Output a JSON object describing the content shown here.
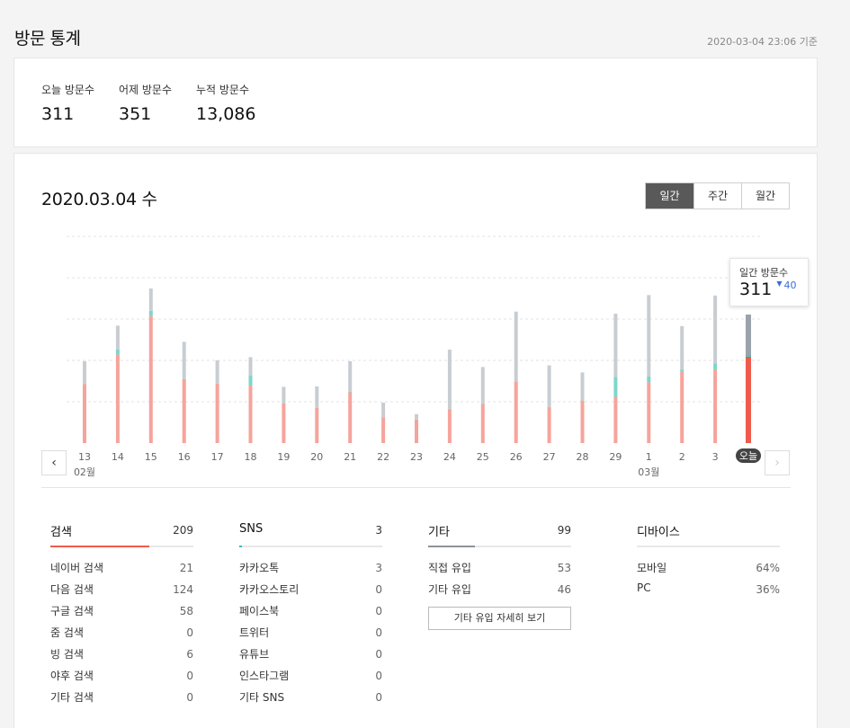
{
  "header": {
    "title": "방문 통계",
    "updated": "2020-03-04 23:06 기준"
  },
  "summary": [
    {
      "label": "오늘 방문수",
      "value": "311"
    },
    {
      "label": "어제 방문수",
      "value": "351"
    },
    {
      "label": "누적 방문수",
      "value": "13,086"
    }
  ],
  "date_title": "2020.03.04 수",
  "period_tabs": [
    "일간",
    "주간",
    "월간"
  ],
  "tooltip": {
    "label": "일간 방문수",
    "value": "311",
    "delta": "40"
  },
  "chart_data": {
    "type": "bar",
    "stacked": true,
    "categories": [
      "13",
      "14",
      "15",
      "16",
      "17",
      "18",
      "19",
      "20",
      "21",
      "22",
      "23",
      "24",
      "25",
      "26",
      "27",
      "28",
      "29",
      "1",
      "2",
      "3",
      "오늘"
    ],
    "month_labels": [
      {
        "index": 0,
        "text": "02월"
      },
      {
        "index": 17,
        "text": "03월"
      }
    ],
    "series": [
      {
        "values": [
          143,
          214,
          307,
          155,
          144,
          139,
          96,
          85,
          123,
          62,
          57,
          82,
          95,
          148,
          86,
          103,
          112,
          147,
          173,
          177,
          209
        ]
      },
      {
        "values": [
          1,
          12,
          13,
          1,
          1,
          24,
          1,
          0,
          1,
          0,
          0,
          1,
          1,
          1,
          1,
          1,
          48,
          14,
          5,
          16,
          3
        ]
      },
      {
        "values": [
          54,
          58,
          54,
          89,
          55,
          45,
          39,
          52,
          74,
          36,
          13,
          143,
          88,
          169,
          101,
          67,
          153,
          197,
          105,
          164,
          99
        ]
      }
    ],
    "colors": [
      "#f5a49c",
      "#7dd6cc",
      "#c8cdd2"
    ],
    "today_colors": [
      "#ee5b4c",
      "#2ec3b8",
      "#9aa3ab"
    ],
    "ylim": [
      0,
      500
    ],
    "grid": true
  },
  "panels": [
    {
      "title": "검색",
      "total": "209",
      "bar_color": "#ee5b4c",
      "bar_fraction": 0.69,
      "rows": [
        {
          "label": "네이버 검색",
          "value": "21"
        },
        {
          "label": "다음 검색",
          "value": "124"
        },
        {
          "label": "구글 검색",
          "value": "58"
        },
        {
          "label": "줌 검색",
          "value": "0"
        },
        {
          "label": "빙 검색",
          "value": "6"
        },
        {
          "label": "야후 검색",
          "value": "0"
        },
        {
          "label": "기타 검색",
          "value": "0"
        }
      ]
    },
    {
      "title": "SNS",
      "total": "3",
      "bar_color": "#2ec3b8",
      "bar_fraction": 0.02,
      "rows": [
        {
          "label": "카카오톡",
          "value": "3"
        },
        {
          "label": "카카오스토리",
          "value": "0"
        },
        {
          "label": "페이스북",
          "value": "0"
        },
        {
          "label": "트위터",
          "value": "0"
        },
        {
          "label": "유튜브",
          "value": "0"
        },
        {
          "label": "인스타그램",
          "value": "0"
        },
        {
          "label": "기타 SNS",
          "value": "0"
        }
      ]
    },
    {
      "title": "기타",
      "total": "99",
      "bar_color": "#8a939b",
      "bar_fraction": 0.33,
      "rows": [
        {
          "label": "직접 유입",
          "value": "53"
        },
        {
          "label": "기타 유입",
          "value": "46"
        }
      ],
      "button": "기타 유입 자세히 보기"
    },
    {
      "title": "디바이스",
      "total": "",
      "bar_color": "#8a939b",
      "bar_fraction": 0,
      "rows": [
        {
          "label": "모바일",
          "value": "64%"
        },
        {
          "label": "PC",
          "value": "36%"
        }
      ]
    }
  ]
}
